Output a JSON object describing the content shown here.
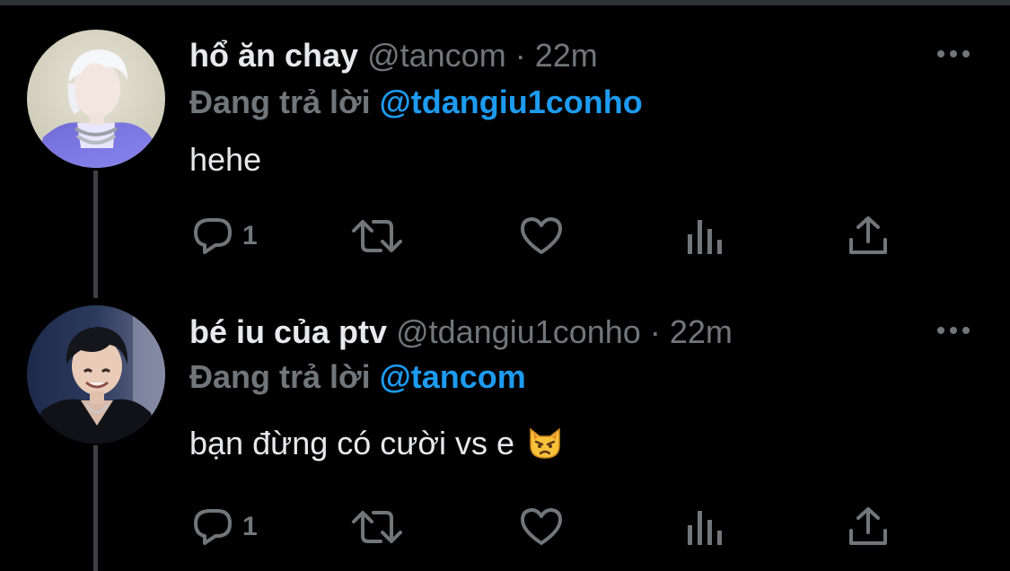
{
  "tweets": [
    {
      "display_name": "hổ ăn chay",
      "handle": "@tancom",
      "separator": "·",
      "time": "22m",
      "reply_prefix": "Đang trả lời",
      "reply_to": "@tdangiu1conho",
      "text": "hehe",
      "emoji": "",
      "reply_count": "1",
      "avatar_icon": "avatar-photo",
      "more_icon": "more-horizontal-icon"
    },
    {
      "display_name": "bé iu của ptv",
      "handle": "@tdangiu1conho",
      "separator": "·",
      "time": "22m",
      "reply_prefix": "Đang trả lời",
      "reply_to": "@tancom",
      "text": "bạn đừng có cười vs e",
      "emoji": "pouting-cat-face",
      "reply_count": "1",
      "avatar_icon": "avatar-photo",
      "more_icon": "more-horizontal-icon"
    }
  ],
  "actions": {
    "reply_icon": "reply-icon",
    "retweet_icon": "retweet-icon",
    "like_icon": "heart-icon",
    "views_icon": "views-icon",
    "share_icon": "share-icon"
  },
  "colors": {
    "background": "#000000",
    "text_primary": "#e7e9ea",
    "text_secondary": "#71767b",
    "accent": "#1d9bf0",
    "thread_line": "#3e4144"
  }
}
